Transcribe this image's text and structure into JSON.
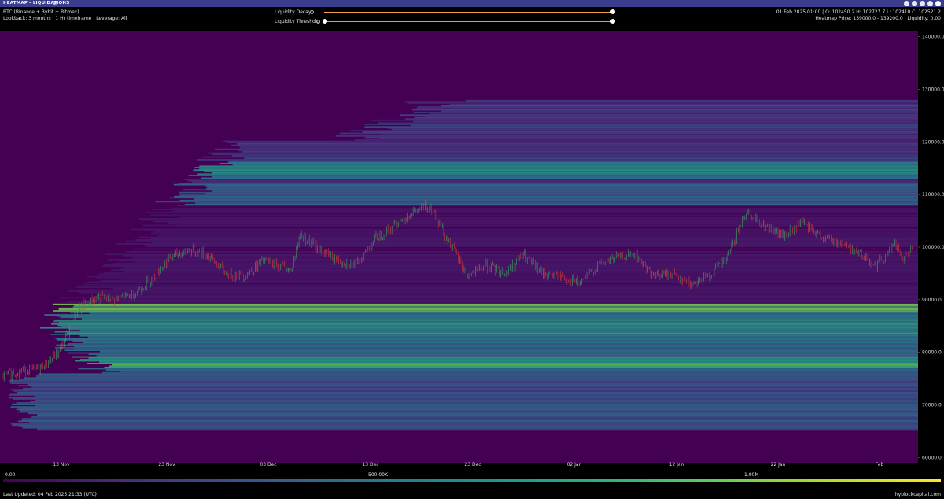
{
  "app": {
    "title": "HEATMAP - LIQUIDATIONS",
    "swap_icon": "swap-arrows-icon",
    "window_icons": [
      "refresh-icon",
      "refresh-icon",
      "link-icon",
      "settings-icon",
      "close-icon"
    ]
  },
  "header": {
    "asset": "BTC (Binance + Bybit + Bitmex)",
    "lookback": "Lookback: 3 months | 1 Hr timeframe | Leverage: All",
    "ohlc": "01 Feb 2025 01:00 | O: 102450.2 H: 102727.7 L: 102410 C: 102521.2",
    "heatmap_price": "Heatmap Price: 139000.0 - 139200.0 | Liquidity: 0.00"
  },
  "controls": {
    "decay_label": "Liquidity Decay",
    "threshold_label": "Liquidity Threshold",
    "decay_value": 1.0,
    "threshold_value": 0.0,
    "track_color": "#e8a24a"
  },
  "chart_data": {
    "type": "heatmap",
    "title": "",
    "x_ticks": [
      "13 Nov",
      "23 Nov",
      "03 Dec",
      "13 Dec",
      "23 Dec",
      "02 Jan",
      "12 Jan",
      "22 Jan",
      "Feb"
    ],
    "y_ticks": [
      "140000.0",
      "130000.0",
      "120000.0",
      "110000.0",
      "100000.0",
      "90000.0",
      "80000.0",
      "70000.0",
      "60000.0"
    ],
    "ylim": [
      59000,
      141000
    ],
    "x_range": [
      "04 Nov 2024",
      "04 Feb 2025"
    ],
    "price_series_approx": [
      [
        0,
        75500
      ],
      [
        2,
        76500
      ],
      [
        4,
        77000
      ],
      [
        6,
        80000
      ],
      [
        8,
        88000
      ],
      [
        10,
        90500
      ],
      [
        12,
        90000
      ],
      [
        14,
        91000
      ],
      [
        16,
        94000
      ],
      [
        18,
        98000
      ],
      [
        20,
        99500
      ],
      [
        22,
        98500
      ],
      [
        24,
        95000
      ],
      [
        26,
        94500
      ],
      [
        28,
        97500
      ],
      [
        30,
        96500
      ],
      [
        31,
        95500
      ],
      [
        32,
        102500
      ],
      [
        34,
        99500
      ],
      [
        36,
        97500
      ],
      [
        38,
        96500
      ],
      [
        40,
        101500
      ],
      [
        42,
        104000
      ],
      [
        44,
        106500
      ],
      [
        46,
        108000
      ],
      [
        48,
        101000
      ],
      [
        50,
        94500
      ],
      [
        52,
        96500
      ],
      [
        54,
        95000
      ],
      [
        56,
        98500
      ],
      [
        58,
        95000
      ],
      [
        60,
        94500
      ],
      [
        62,
        93000
      ],
      [
        64,
        96500
      ],
      [
        66,
        98000
      ],
      [
        68,
        98500
      ],
      [
        70,
        94500
      ],
      [
        72,
        95000
      ],
      [
        74,
        93000
      ],
      [
        76,
        94500
      ],
      [
        78,
        98000
      ],
      [
        80,
        107000
      ],
      [
        82,
        104000
      ],
      [
        84,
        102000
      ],
      [
        86,
        104500
      ],
      [
        88,
        102000
      ],
      [
        90,
        101000
      ],
      [
        92,
        99000
      ],
      [
        94,
        96500
      ],
      [
        96,
        100500
      ],
      [
        97,
        97500
      ],
      [
        98,
        101000
      ]
    ],
    "heat_bands": [
      {
        "low": 87500,
        "high": 89000,
        "intensity": 0.95
      },
      {
        "low": 83000,
        "high": 87000,
        "intensity": 0.65
      },
      {
        "low": 77000,
        "high": 79000,
        "intensity": 0.85
      },
      {
        "low": 79000,
        "high": 83000,
        "intensity": 0.5
      },
      {
        "low": 113000,
        "high": 116000,
        "intensity": 0.6
      },
      {
        "low": 108000,
        "high": 112000,
        "intensity": 0.4
      }
    ],
    "colorbar": {
      "min": "0.00",
      "mid": "500.00K",
      "max": "1.00M"
    }
  },
  "footer": {
    "last_updated": "Last Updated: 04 Feb 2025 21:33 (UTC)",
    "brand": "hyblockcapital.com"
  }
}
